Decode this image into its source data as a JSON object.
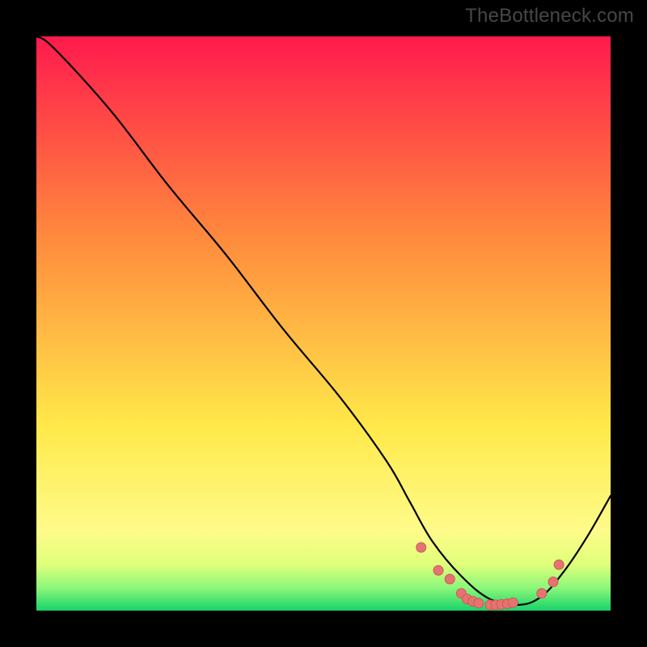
{
  "watermark": "TheBottleneck.com",
  "colors": {
    "frame": "#000000",
    "curve": "#000000",
    "marker_fill": "#e57373",
    "marker_stroke": "#d2594c",
    "grad_top": "#ff1a4d",
    "grad_mid1": "#ff8a3d",
    "grad_mid2": "#ffe94a",
    "grad_band1": "#fffb8a",
    "grad_band2": "#dfff7a",
    "grad_band3": "#8cf77a",
    "grad_bottom": "#18d46a"
  },
  "chart_data": {
    "type": "line",
    "title": "",
    "xlabel": "",
    "ylabel": "",
    "xlim": [
      0,
      100
    ],
    "ylim": [
      0,
      100
    ],
    "series": [
      {
        "name": "curve",
        "x": [
          0,
          3,
          13,
          23,
          33,
          43,
          53,
          61,
          65,
          69,
          74,
          79,
          84,
          88,
          92,
          96,
          100
        ],
        "y": [
          100,
          98,
          87,
          74,
          62,
          49,
          37,
          26,
          19,
          12,
          6,
          2,
          1,
          2.5,
          7,
          13,
          20
        ]
      }
    ],
    "markers": {
      "name": "flat-region-points",
      "x": [
        67,
        70,
        72,
        74,
        75,
        76,
        77,
        79,
        80,
        81,
        82,
        83,
        88,
        90,
        91
      ],
      "y": [
        11,
        7,
        5.5,
        3,
        2,
        1.6,
        1.3,
        1,
        1,
        1.1,
        1.2,
        1.4,
        3,
        5,
        8
      ]
    }
  }
}
